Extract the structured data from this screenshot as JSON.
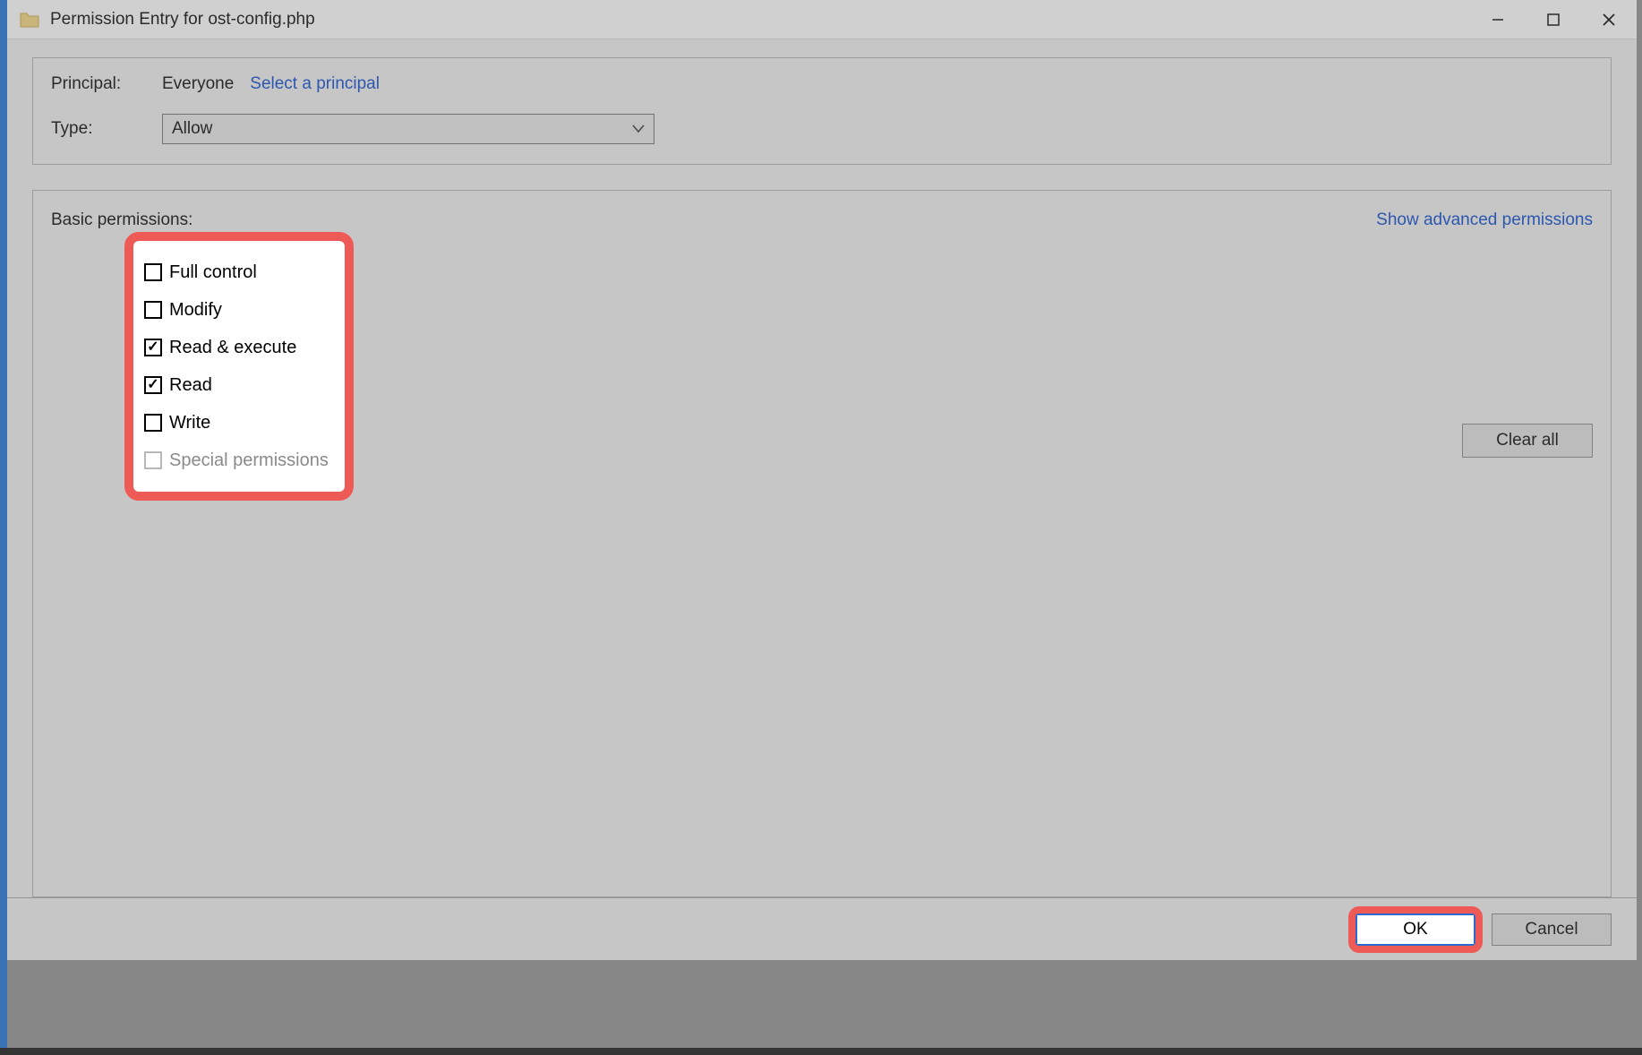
{
  "window": {
    "title": "Permission Entry for ost-config.php"
  },
  "principal": {
    "label": "Principal:",
    "value": "Everyone",
    "select_link": "Select a principal"
  },
  "type": {
    "label": "Type:",
    "value": "Allow"
  },
  "permissions": {
    "basic_label": "Basic permissions:",
    "advanced_link": "Show advanced permissions",
    "items": [
      {
        "label": "Full control",
        "checked": false,
        "disabled": false
      },
      {
        "label": "Modify",
        "checked": false,
        "disabled": false
      },
      {
        "label": "Read & execute",
        "checked": true,
        "disabled": false
      },
      {
        "label": "Read",
        "checked": true,
        "disabled": false
      },
      {
        "label": "Write",
        "checked": false,
        "disabled": false
      },
      {
        "label": "Special permissions",
        "checked": false,
        "disabled": true
      }
    ],
    "clear_all": "Clear all"
  },
  "buttons": {
    "ok": "OK",
    "cancel": "Cancel"
  }
}
